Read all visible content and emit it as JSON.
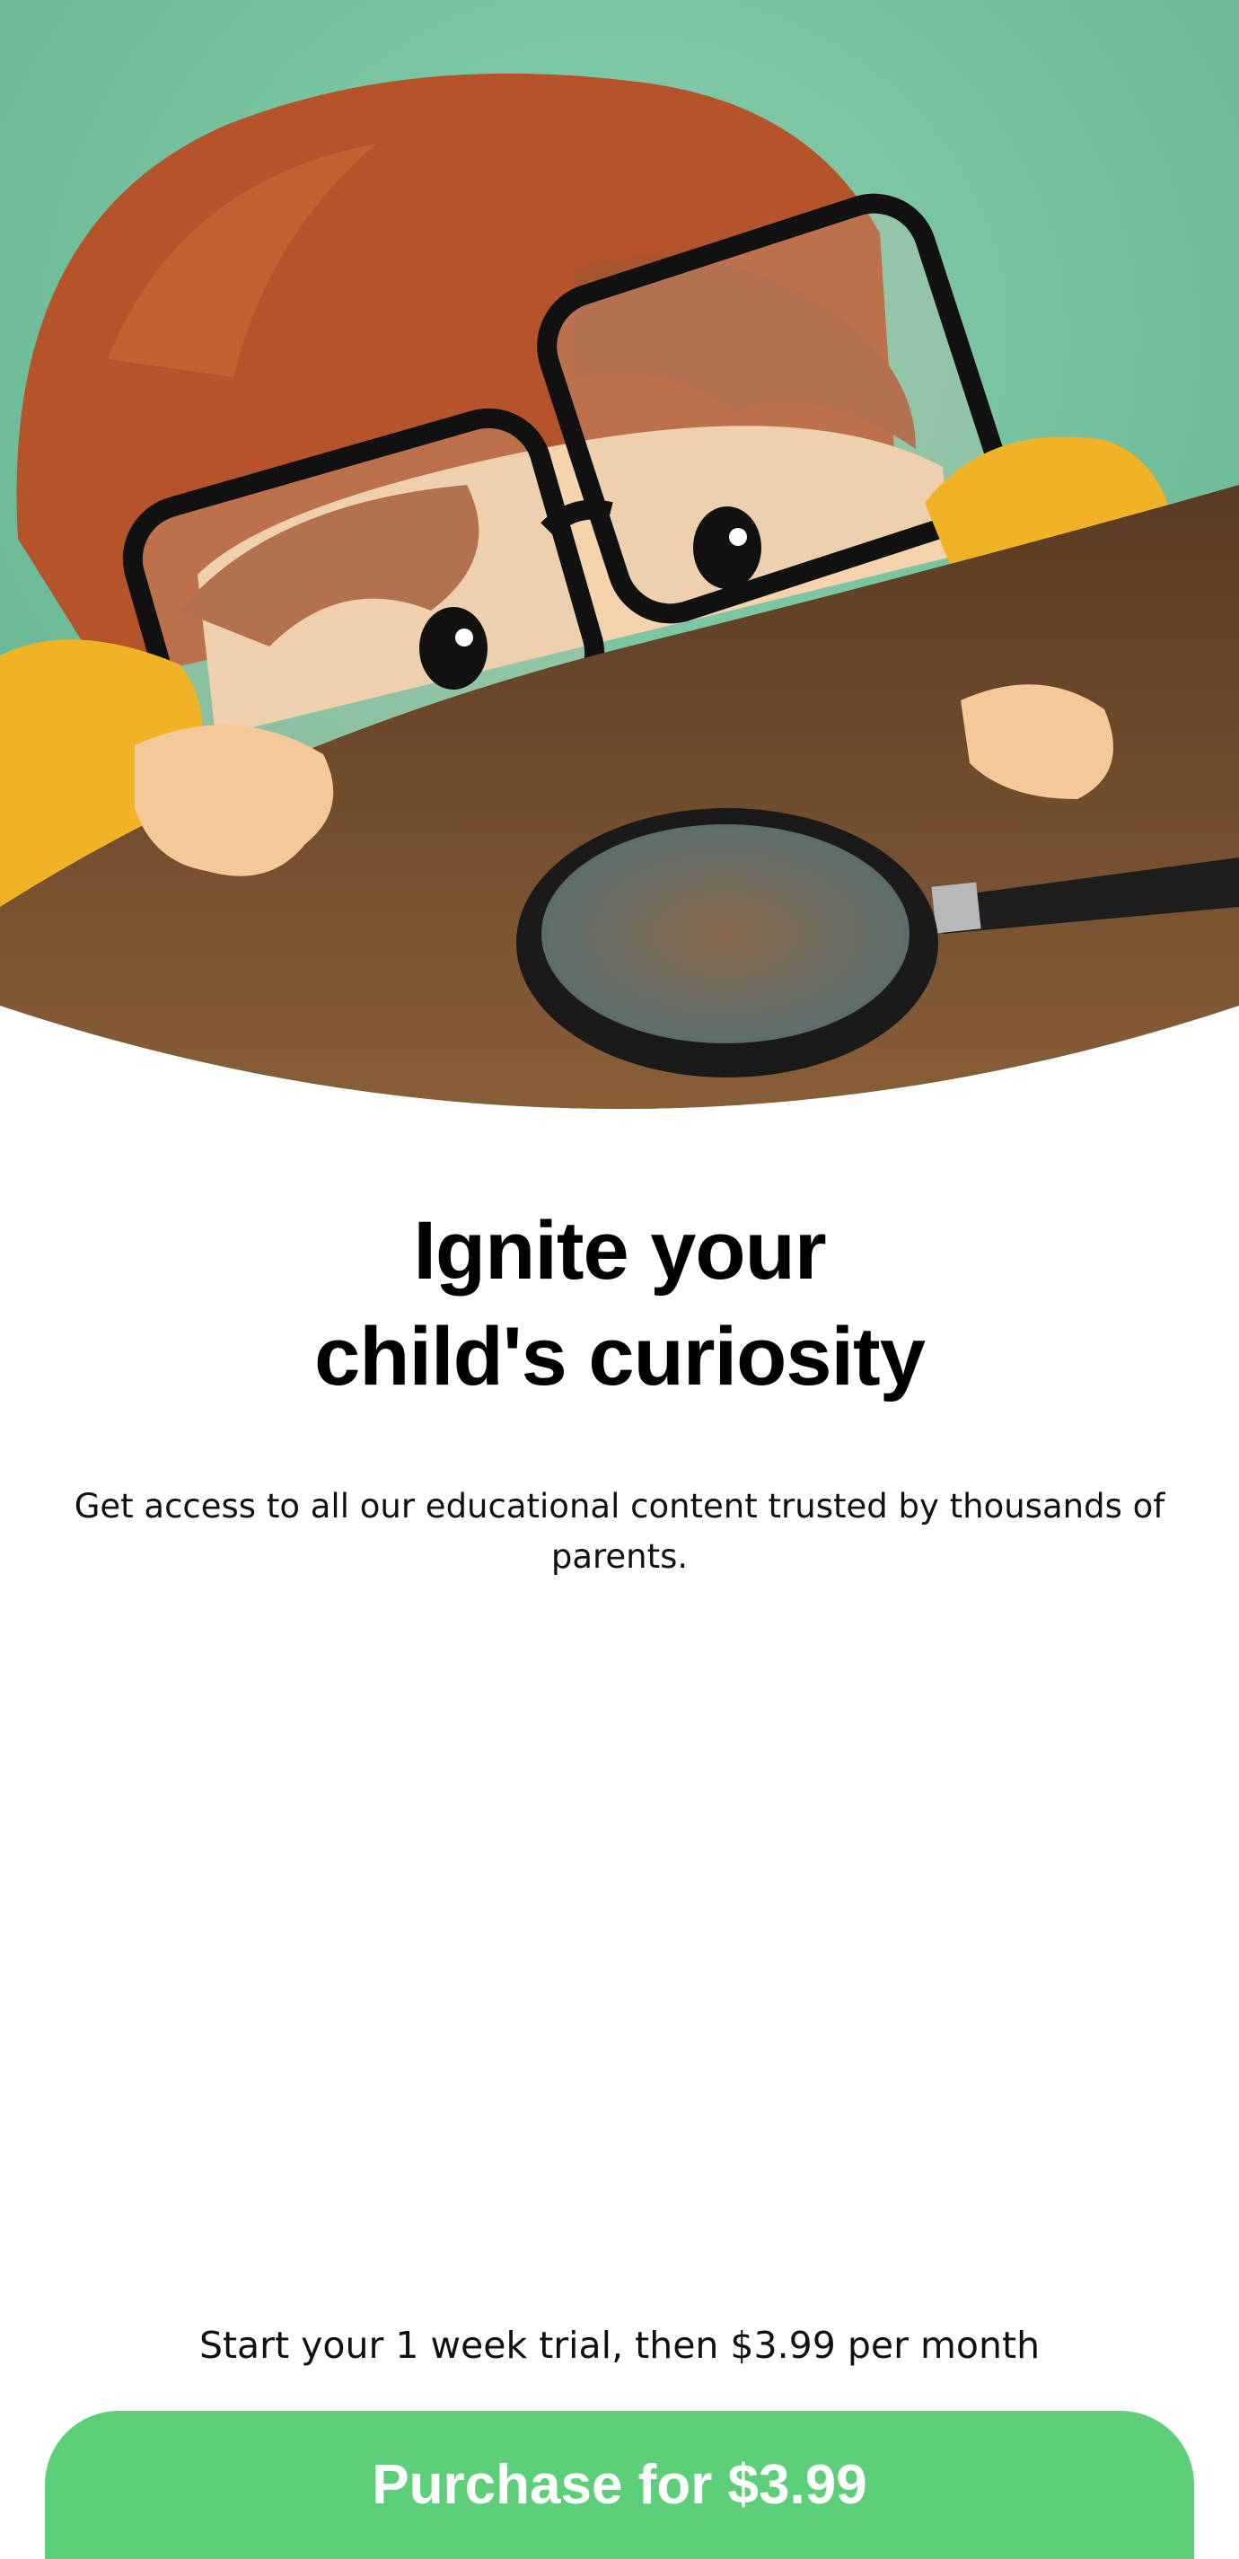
{
  "hero": {
    "image": "child-with-glasses-and-magnifying-glass-illustration"
  },
  "headline": {
    "line1": "Ignite your",
    "line2": "child's curiosity"
  },
  "subtitle": "Get access to all our educational content trusted by thousands of parents.",
  "trial_text": "Start your 1 week trial, then $3.99 per month",
  "purchase_button": {
    "label": "Purchase for $3.99"
  },
  "colors": {
    "button": "#5ecf79",
    "background_green": "#6bbd98",
    "table": "#6e4a2c",
    "sweater": "#f0b325",
    "hair": "#b5532a"
  }
}
